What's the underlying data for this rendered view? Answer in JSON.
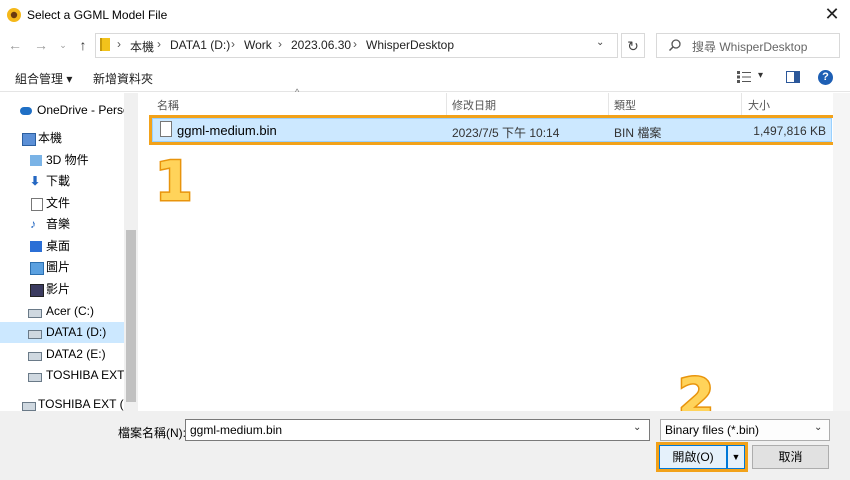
{
  "window": {
    "title": "Select a GGML Model File"
  },
  "address": {
    "crumbs": [
      "本機",
      "DATA1 (D:)",
      "Work",
      "2023.06.30",
      "WhisperDesktop"
    ],
    "separator": "›"
  },
  "search": {
    "placeholder": "搜尋 WhisperDesktop"
  },
  "toolbar": {
    "organize": "組合管理 ▾",
    "new_folder": "新增資料夾"
  },
  "sidebar": {
    "items": [
      {
        "label": "OneDrive - Perso",
        "icon": "cloud-icon"
      },
      {
        "label": "本機",
        "icon": "computer-icon"
      },
      {
        "label": "3D 物件",
        "icon": "3d-objects-icon"
      },
      {
        "label": "下載",
        "icon": "download-icon"
      },
      {
        "label": "文件",
        "icon": "document-icon"
      },
      {
        "label": "音樂",
        "icon": "music-icon"
      },
      {
        "label": "桌面",
        "icon": "desktop-icon"
      },
      {
        "label": "圖片",
        "icon": "pictures-icon"
      },
      {
        "label": "影片",
        "icon": "videos-icon"
      },
      {
        "label": "Acer (C:)",
        "icon": "drive-icon"
      },
      {
        "label": "DATA1 (D:)",
        "icon": "drive-icon",
        "selected": true
      },
      {
        "label": "DATA2 (E:)",
        "icon": "drive-icon"
      },
      {
        "label": "TOSHIBA EXT (F",
        "icon": "drive-icon"
      },
      {
        "label": "TOSHIBA EXT (F:)",
        "icon": "drive-icon"
      }
    ]
  },
  "columns": {
    "name": "名稱",
    "date": "修改日期",
    "type": "類型",
    "size": "大小"
  },
  "files": [
    {
      "name": "ggml-medium.bin",
      "date": "2023/7/5 下午 10:14",
      "type": "BIN 檔案",
      "size": "1,497,816 KB"
    }
  ],
  "callouts": {
    "one": "1",
    "two": "2"
  },
  "footer": {
    "filename_label": "檔案名稱(N):",
    "filename_value": "ggml-medium.bin",
    "filter_value": "Binary files (*.bin)",
    "open_label": "開啟(O)",
    "cancel_label": "取消"
  },
  "colors": {
    "highlight": "#f2a21a",
    "selection": "#cce8ff",
    "accent": "#0078d7"
  }
}
